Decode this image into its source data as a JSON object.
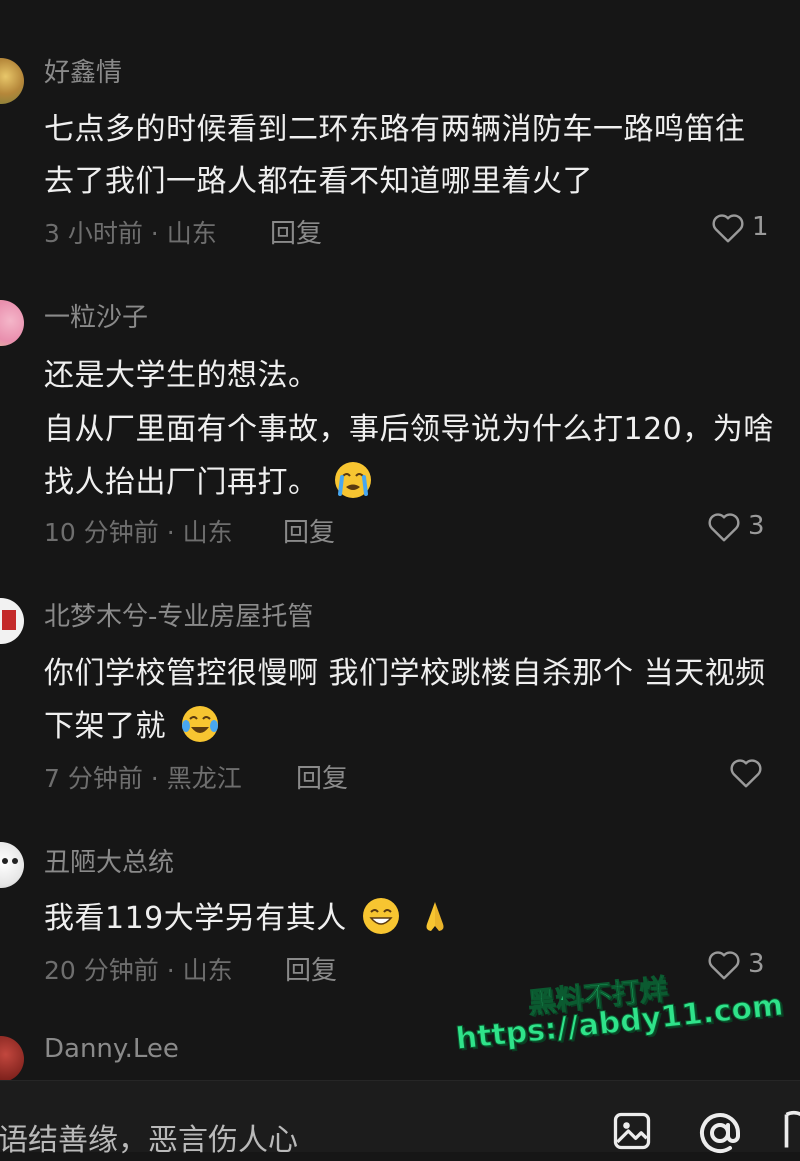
{
  "comments": [
    {
      "username": "好鑫情",
      "lines": [
        "七点多的时候看到二环东路有两辆消防车一路鸣笛往",
        "去了我们一路人都在看不知道哪里着火了"
      ],
      "meta": "3 小时前 · 山东",
      "reply_label": "回复",
      "likes": "1"
    },
    {
      "username": "一粒沙子",
      "lines": [
        "还是大学生的想法。",
        "自从厂里面有个事故，事后领导说为什么打120，为啥",
        "找人抬出厂门再打。"
      ],
      "meta": "10 分钟前 · 山东",
      "reply_label": "回复",
      "likes": "3"
    },
    {
      "username": "北梦木兮-专业房屋托管",
      "lines": [
        "你们学校管控很慢啊 我们学校跳楼自杀那个 当天视频",
        "下架了就"
      ],
      "meta": "7 分钟前 · 黑龙江",
      "reply_label": "回复",
      "likes": ""
    },
    {
      "username": "丑陋大总统",
      "lines": [
        "我看119大学另有其人"
      ],
      "meta": "20 分钟前 · 山东",
      "reply_label": "回复",
      "likes": "3"
    },
    {
      "username": "Danny.Lee"
    }
  ],
  "input": {
    "placeholder": "语结善缘，恶言伤人心"
  },
  "watermark": {
    "line1": "黑料不打烊",
    "line2": "https://abdy11.com"
  },
  "icons": {
    "like": "heart-outline-icon",
    "image": "image-icon",
    "mention": "at-icon"
  },
  "colors": {
    "background": "#161616",
    "watermark": "#2fe38a"
  }
}
